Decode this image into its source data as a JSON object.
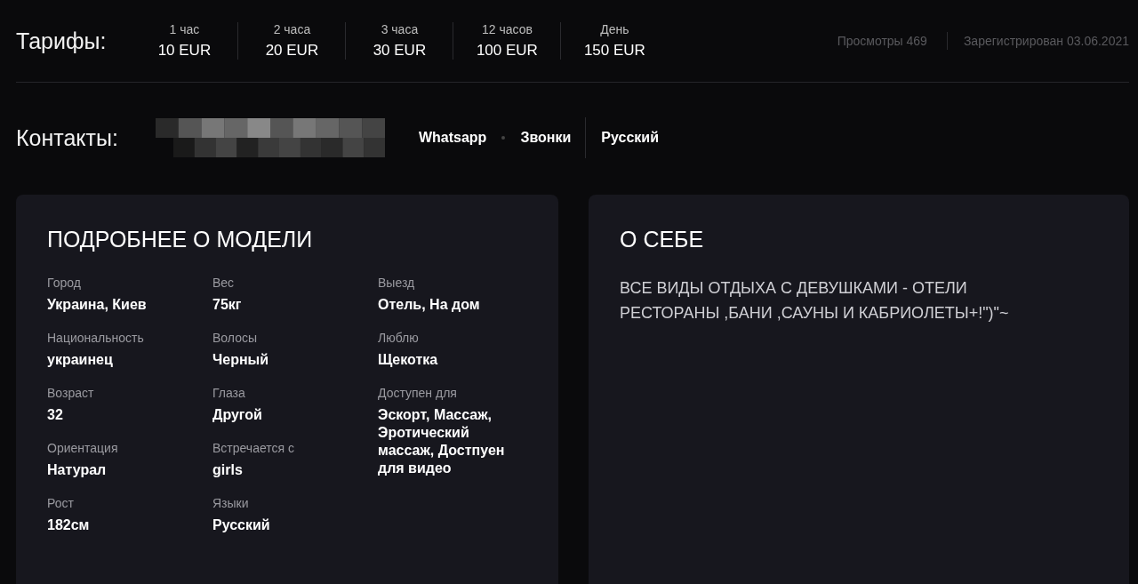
{
  "rates": {
    "title": "Тарифы:",
    "items": [
      {
        "period": "1 час",
        "price": "10 EUR"
      },
      {
        "period": "2 часа",
        "price": "20 EUR"
      },
      {
        "period": "3 часа",
        "price": "30 EUR"
      },
      {
        "period": "12 часов",
        "price": "100 EUR"
      },
      {
        "period": "День",
        "price": "150 EUR"
      }
    ]
  },
  "stats": [
    "Просмотры 469",
    "Зарегистрирован 03.06.2021"
  ],
  "contacts": {
    "title": "Контакты:",
    "messengers": [
      "Whatsapp",
      "Звонки"
    ],
    "language": "Русский"
  },
  "details": {
    "title": "ПОДРОБНЕЕ О МОДЕЛИ",
    "columns": [
      [
        {
          "label": "Город",
          "value": "Украина, Киев"
        },
        {
          "label": "Национальность",
          "value": "украинец"
        },
        {
          "label": "Возраст",
          "value": "32"
        },
        {
          "label": "Ориентация",
          "value": "Натурал"
        },
        {
          "label": "Рост",
          "value": "182см"
        }
      ],
      [
        {
          "label": "Вес",
          "value": "75кг"
        },
        {
          "label": "Волосы",
          "value": "Черный"
        },
        {
          "label": "Глаза",
          "value": "Другой"
        },
        {
          "label": "Встречается с",
          "value": "girls"
        },
        {
          "label": "Языки",
          "value": "Русский"
        }
      ],
      [
        {
          "label": "Выезд",
          "value": "Отель, На дом"
        },
        {
          "label": "Люблю",
          "value": "Щекотка"
        },
        {
          "label": "Доступен для",
          "value": "Эскорт, Массаж, Эротический массаж, Достпуен для видео"
        }
      ]
    ]
  },
  "about": {
    "title": "О СЕБЕ",
    "text": "ВСЕ ВИДЫ ОТДЫХА С ДЕВУШКАМИ - ОТЕЛИ РЕСТОРАНЫ ,БАНИ ,САУНЫ И КАБРИОЛЕТЫ+!\")\"~"
  }
}
